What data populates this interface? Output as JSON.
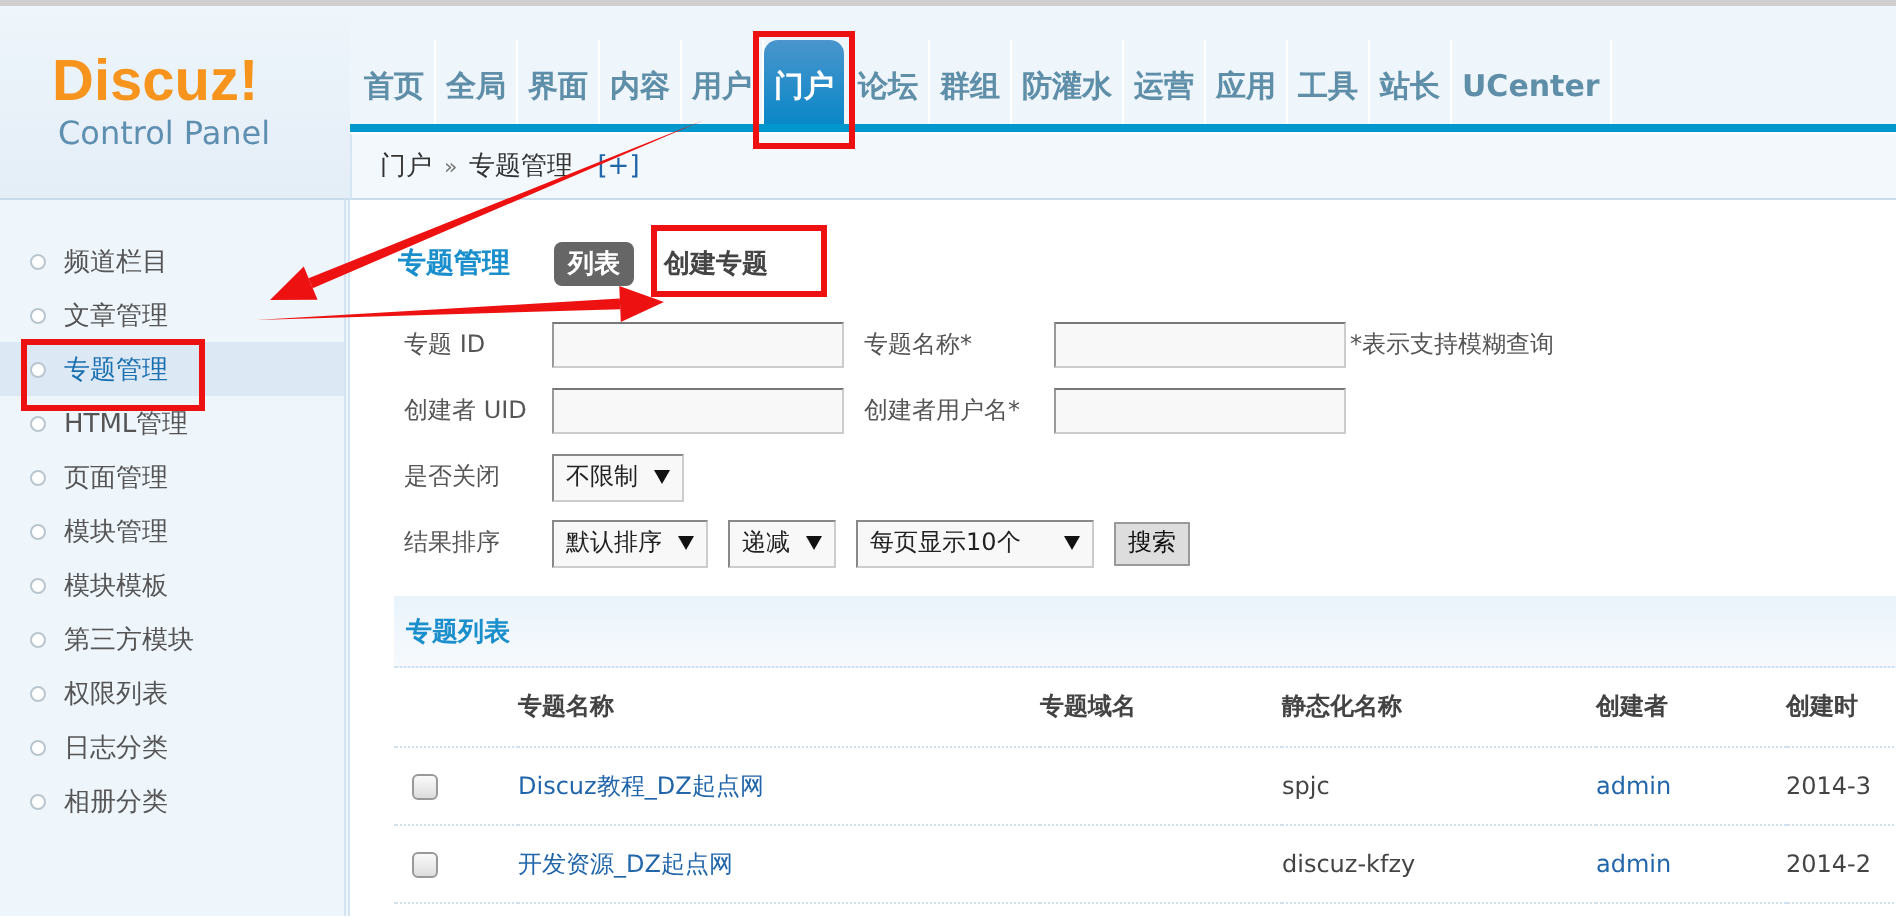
{
  "logo": {
    "name": "Discuz!",
    "subtitle": "Control Panel"
  },
  "nav": [
    {
      "label": "首页",
      "selected": false
    },
    {
      "label": "全局",
      "selected": false
    },
    {
      "label": "界面",
      "selected": false
    },
    {
      "label": "内容",
      "selected": false
    },
    {
      "label": "用户",
      "selected": false
    },
    {
      "label": "门户",
      "selected": true
    },
    {
      "label": "论坛",
      "selected": false
    },
    {
      "label": "群组",
      "selected": false
    },
    {
      "label": "防灌水",
      "selected": false
    },
    {
      "label": "运营",
      "selected": false
    },
    {
      "label": "应用",
      "selected": false
    },
    {
      "label": "工具",
      "selected": false
    },
    {
      "label": "站长",
      "selected": false
    },
    {
      "label": "UCenter",
      "selected": false
    }
  ],
  "breadcrumb": {
    "items": [
      "门户",
      "专题管理"
    ],
    "separator": "»",
    "add": "[+]"
  },
  "sidebar": {
    "items": [
      {
        "label": "频道栏目",
        "selected": false
      },
      {
        "label": "文章管理",
        "selected": false
      },
      {
        "label": "专题管理",
        "selected": true
      },
      {
        "label": "HTML管理",
        "selected": false
      },
      {
        "label": "页面管理",
        "selected": false
      },
      {
        "label": "模块管理",
        "selected": false
      },
      {
        "label": "模块模板",
        "selected": false
      },
      {
        "label": "第三方模块",
        "selected": false
      },
      {
        "label": "权限列表",
        "selected": false
      },
      {
        "label": "日志分类",
        "selected": false
      },
      {
        "label": "相册分类",
        "selected": false
      }
    ]
  },
  "page": {
    "title": "专题管理",
    "tabs": [
      {
        "label": "列表",
        "selected": true
      },
      {
        "label": "创建专题",
        "selected": false
      }
    ]
  },
  "filters": [
    {
      "label": "专题 ID",
      "controls": [
        {
          "kind": "input"
        },
        {
          "kind": "label",
          "text": "专题名称*"
        },
        {
          "kind": "input"
        },
        {
          "kind": "hint",
          "text": "*表示支持模糊查询"
        }
      ]
    },
    {
      "label": "创建者 UID",
      "controls": [
        {
          "kind": "input"
        },
        {
          "kind": "label",
          "text": "创建者用户名*"
        },
        {
          "kind": "input"
        }
      ]
    },
    {
      "label": "是否关闭",
      "controls": [
        {
          "kind": "select",
          "value": "不限制"
        }
      ]
    },
    {
      "label": "结果排序",
      "controls": [
        {
          "kind": "select",
          "value": "默认排序"
        },
        {
          "kind": "select",
          "value": "递减"
        },
        {
          "kind": "select",
          "value": "每页显示10个",
          "wide": true
        },
        {
          "kind": "button",
          "text": "搜索"
        }
      ]
    }
  ],
  "table": {
    "title": "专题列表",
    "columns": [
      "专题名称",
      "专题域名",
      "静态化名称",
      "创建者",
      "创建时"
    ],
    "rows": [
      {
        "checked": false,
        "name": "Discuz教程_DZ起点网",
        "static_name": "spjc",
        "creator": "admin",
        "created": "2014-3"
      },
      {
        "checked": false,
        "name": "开发资源_DZ起点网",
        "static_name": "discuz-kfzy",
        "creator": "admin",
        "created": "2014-2"
      }
    ]
  },
  "annotations": [
    {
      "kind": "frame"
    },
    {
      "kind": "frame"
    },
    {
      "kind": "frame"
    },
    {
      "kind": "arrow"
    },
    {
      "kind": "arrow"
    }
  ]
}
